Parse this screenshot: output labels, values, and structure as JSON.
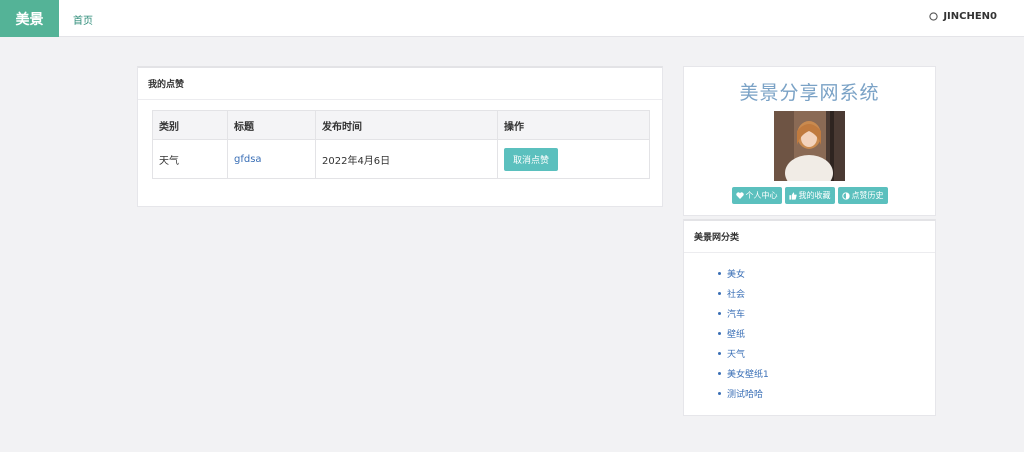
{
  "navbar": {
    "brand": "美景",
    "home": "首页",
    "username": "JINCHEN0"
  },
  "likes": {
    "heading": "我的点赞",
    "columns": [
      "类别",
      "标题",
      "发布时间",
      "操作"
    ],
    "rows": [
      {
        "category": "天气",
        "title": "gfdsa",
        "date": "2022年4月6日",
        "action": "取消点赞"
      }
    ]
  },
  "profile": {
    "site_title": "美景分享网系统",
    "buttons": [
      "个人中心",
      "我的收藏",
      "点赞历史"
    ]
  },
  "categories": {
    "heading": "美景网分类",
    "items": [
      "美女",
      "社会",
      "汽车",
      "壁纸",
      "天气",
      "美女壁纸1",
      "测试哈哈"
    ]
  },
  "colors": {
    "brand": "#54b397",
    "accent": "#5bc0be",
    "link": "#3a6fb6"
  }
}
